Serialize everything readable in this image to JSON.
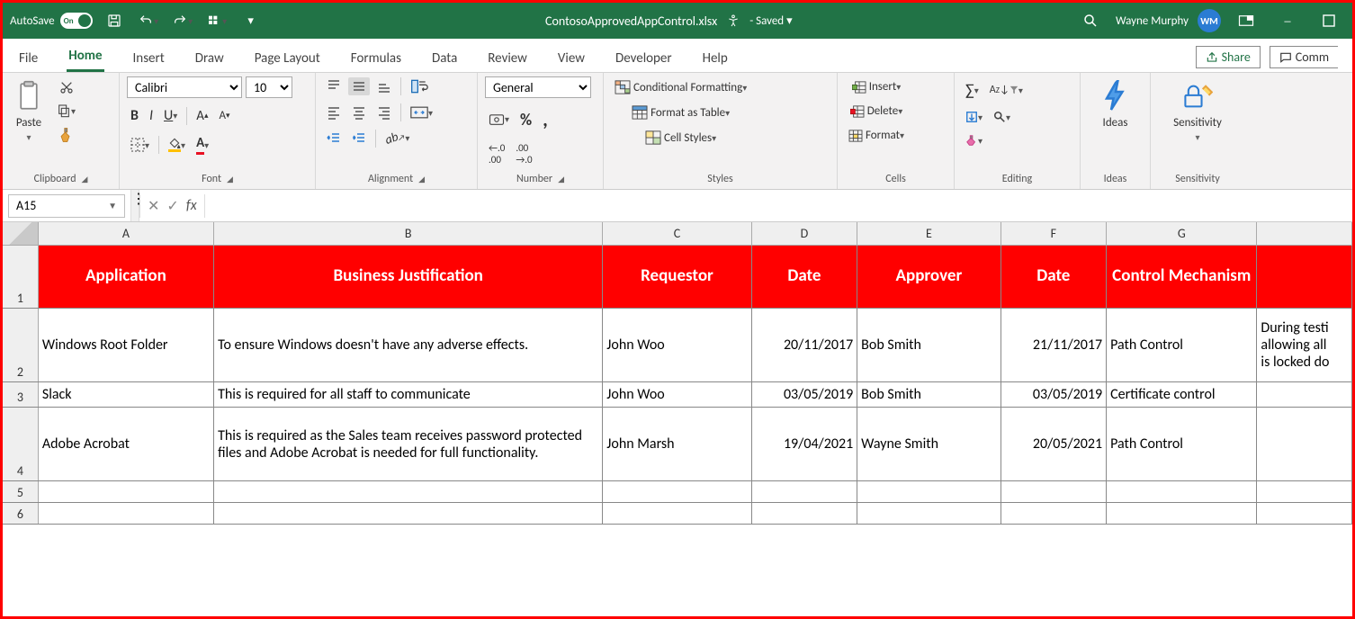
{
  "titlebar": {
    "autosave_label": "AutoSave",
    "autosave_state": "On",
    "doc_name": "ContosoApprovedAppControl.xlsx",
    "save_state": "Saved",
    "user_name": "Wayne Murphy",
    "user_initials": "WM"
  },
  "tabs": {
    "file": "File",
    "home": "Home",
    "insert": "Insert",
    "draw": "Draw",
    "page_layout": "Page Layout",
    "formulas": "Formulas",
    "data": "Data",
    "review": "Review",
    "view": "View",
    "developer": "Developer",
    "help": "Help",
    "share": "Share",
    "comments": "Comm"
  },
  "ribbon": {
    "clipboard": {
      "paste": "Paste",
      "label": "Clipboard"
    },
    "font": {
      "name": "Calibri",
      "size": "10",
      "label": "Font"
    },
    "alignment": {
      "label": "Alignment"
    },
    "number": {
      "format": "General",
      "label": "Number"
    },
    "styles": {
      "conditional": "Conditional Formatting",
      "table": "Format as Table",
      "cell_styles": "Cell Styles",
      "label": "Styles"
    },
    "cells": {
      "insert": "Insert",
      "delete": "Delete",
      "format": "Format",
      "label": "Cells"
    },
    "editing": {
      "label": "Editing"
    },
    "ideas": {
      "btn": "Ideas",
      "label": "Ideas"
    },
    "sensitivity": {
      "btn": "Sensitivity",
      "label": "Sensitivity"
    }
  },
  "formula_bar": {
    "cell_ref": "A15",
    "cancel": "✕",
    "enter": "✓",
    "fx": "fx",
    "value": ""
  },
  "columns": {
    "A": "A",
    "B": "B",
    "C": "C",
    "D": "D",
    "E": "E",
    "F": "F",
    "G": "G"
  },
  "headers": {
    "application": "Application",
    "justification": "Business Justification",
    "requestor": "Requestor",
    "date1": "Date",
    "approver": "Approver",
    "date2": "Date",
    "control": "Control Mechanism"
  },
  "rows": [
    {
      "n": "2",
      "app": "Windows Root Folder",
      "just": "To ensure Windows doesn't have any adverse effects.",
      "req": "John Woo",
      "d1": "20/11/2017",
      "appr": "Bob Smith",
      "d2": "21/11/2017",
      "ctrl": "Path Control",
      "extra": "During testi\nallowing all\nis locked do"
    },
    {
      "n": "3",
      "app": "Slack",
      "just": "This is required for all staff to communicate",
      "req": "John Woo",
      "d1": "03/05/2019",
      "appr": "Bob Smith",
      "d2": "03/05/2019",
      "ctrl": "Certificate control",
      "extra": ""
    },
    {
      "n": "4",
      "app": "Adobe Acrobat",
      "just": "This is required as the Sales team receives password protected files and Adobe Acrobat is needed for full functionality.",
      "req": "John Marsh",
      "d1": "19/04/2021",
      "appr": "Wayne Smith",
      "d2": "20/05/2021",
      "ctrl": "Path Control",
      "extra": ""
    },
    {
      "n": "5",
      "app": "",
      "just": "",
      "req": "",
      "d1": "",
      "appr": "",
      "d2": "",
      "ctrl": "",
      "extra": ""
    },
    {
      "n": "6",
      "app": "",
      "just": "",
      "req": "",
      "d1": "",
      "appr": "",
      "d2": "",
      "ctrl": "",
      "extra": ""
    }
  ]
}
